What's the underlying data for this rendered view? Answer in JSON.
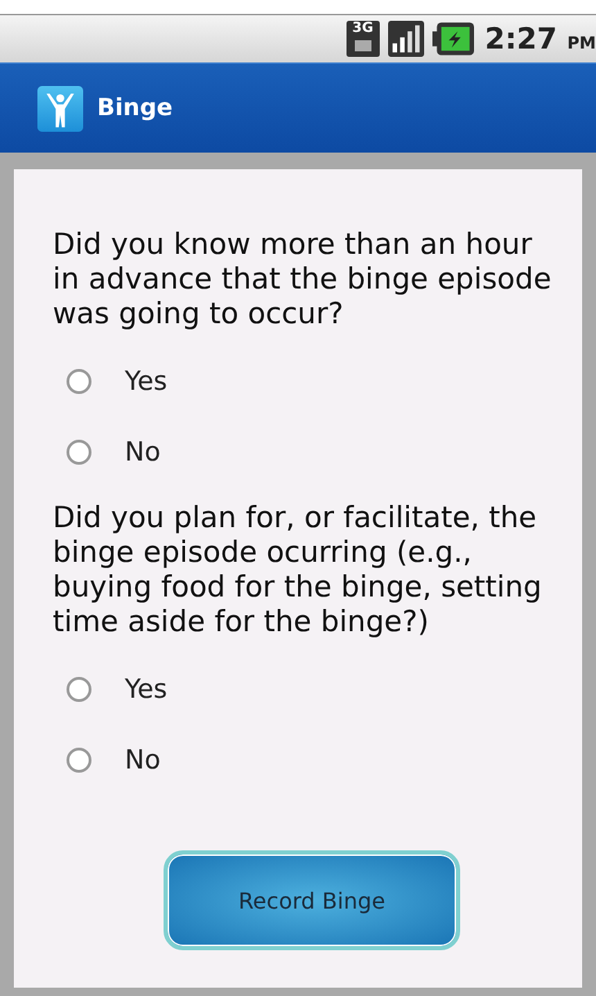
{
  "status_bar": {
    "network": "3G",
    "time": "2:27",
    "meridiem": "PM"
  },
  "title_bar": {
    "title": "Binge"
  },
  "questions": [
    {
      "text": "Did you know more than an hour in advance that the binge episode was going to occur?",
      "options": [
        {
          "label": "Yes",
          "selected": false
        },
        {
          "label": "No",
          "selected": false
        }
      ]
    },
    {
      "text": "Did you plan for, or facilitate, the binge episode ocurring (e.g., buying food for the binge, setting time aside for the binge?)",
      "options": [
        {
          "label": "Yes",
          "selected": false
        },
        {
          "label": "No",
          "selected": false
        }
      ]
    }
  ],
  "button": {
    "label": "Record Binge"
  }
}
